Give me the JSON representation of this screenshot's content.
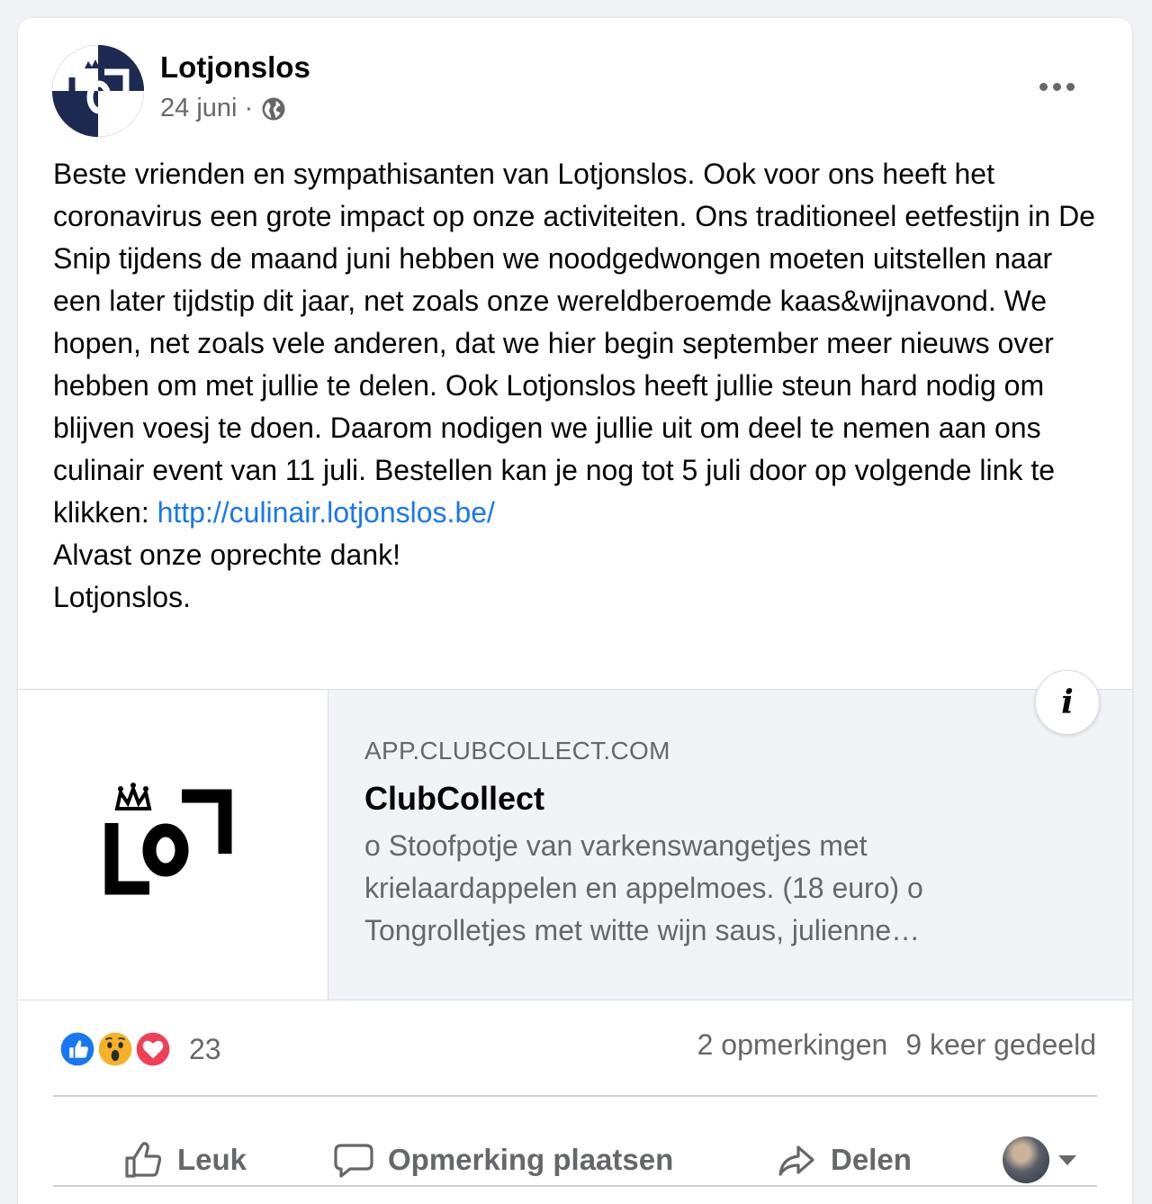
{
  "post": {
    "page_name": "Lotjonslos",
    "date": "24 juni",
    "separator": "·",
    "text_before_link": "Beste vrienden en sympathisanten van Lotjonslos. Ook voor ons heeft het coronavirus een grote impact op onze activiteiten. Ons traditioneel eetfestijn in De Snip tijdens de maand juni hebben we noodgedwongen moeten uitstellen naar een later tijdstip dit jaar, net zoals onze wereldberoemde kaas&wijnavond. We hopen, net zoals vele anderen, dat we hier begin september meer nieuws over hebben om met jullie te delen. Ook Lotjonslos heeft jullie steun hard nodig om blijven voesj te doen. Daarom nodigen we jullie uit om deel te nemen aan ons culinair event van 11 juli. Bestellen kan je nog tot 5 juli door op volgende link te klikken: ",
    "link": "http://culinair.lotjonslos.be/",
    "text_after_link": "\nAlvast onze oprechte dank!\nLotjonslos."
  },
  "preview": {
    "domain": "APP.CLUBCOLLECT.COM",
    "title": "ClubCollect",
    "description": "o Stoofpotje van varkenswangetjes met krielaardappelen en appelmoes. (18 euro) o Tongrolletjes met witte wijn saus, julienne…",
    "info_label": "i"
  },
  "engagement": {
    "reaction_count": "23",
    "comments": "2 opmerkingen",
    "shares": "9 keer gedeeld",
    "reaction_icons": [
      "like-icon",
      "wow-icon",
      "love-icon"
    ]
  },
  "actions": {
    "like": "Leuk",
    "comment": "Opmerking plaatsen",
    "share": "Delen"
  },
  "colors": {
    "link": "#1877f2",
    "like_blue": "#1877f2",
    "love_red": "#f33e58",
    "wow_yellow": "#f7b125",
    "secondary_text": "#65676b"
  }
}
